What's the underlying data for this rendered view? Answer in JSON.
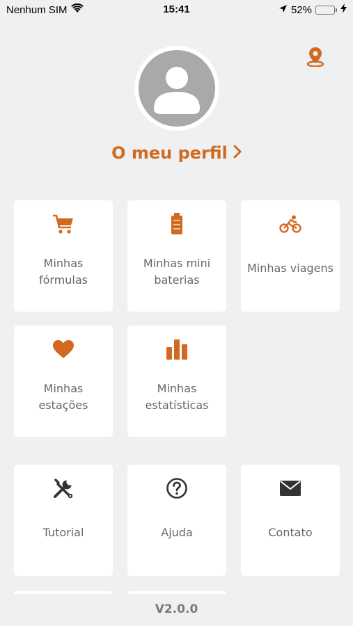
{
  "status_bar": {
    "carrier": "Nenhum SIM",
    "time": "15:41",
    "battery_percent": "52%",
    "battery_level": 0.52
  },
  "profile": {
    "link_label": "O meu perfil"
  },
  "colors": {
    "accent": "#d2691e",
    "background": "#eef0f1",
    "tile": "#ffffff",
    "text": "#666666",
    "icon_dark": "#333333"
  },
  "tiles": [
    {
      "label": "Minhas fórmulas",
      "icon": "cart-icon"
    },
    {
      "label": "Minhas mini baterias",
      "icon": "battery-icon"
    },
    {
      "label": "Minhas viagens",
      "icon": "bicycle-icon"
    },
    {
      "label": "Minhas estações",
      "icon": "heart-icon"
    },
    {
      "label": "Minhas estatísticas",
      "icon": "bar-chart-icon"
    }
  ],
  "support_tiles": [
    {
      "label": "Tutorial",
      "icon": "tools-icon"
    },
    {
      "label": "Ajuda",
      "icon": "help-icon"
    },
    {
      "label": "Contato",
      "icon": "envelope-icon"
    }
  ],
  "version": "V2.0.0"
}
